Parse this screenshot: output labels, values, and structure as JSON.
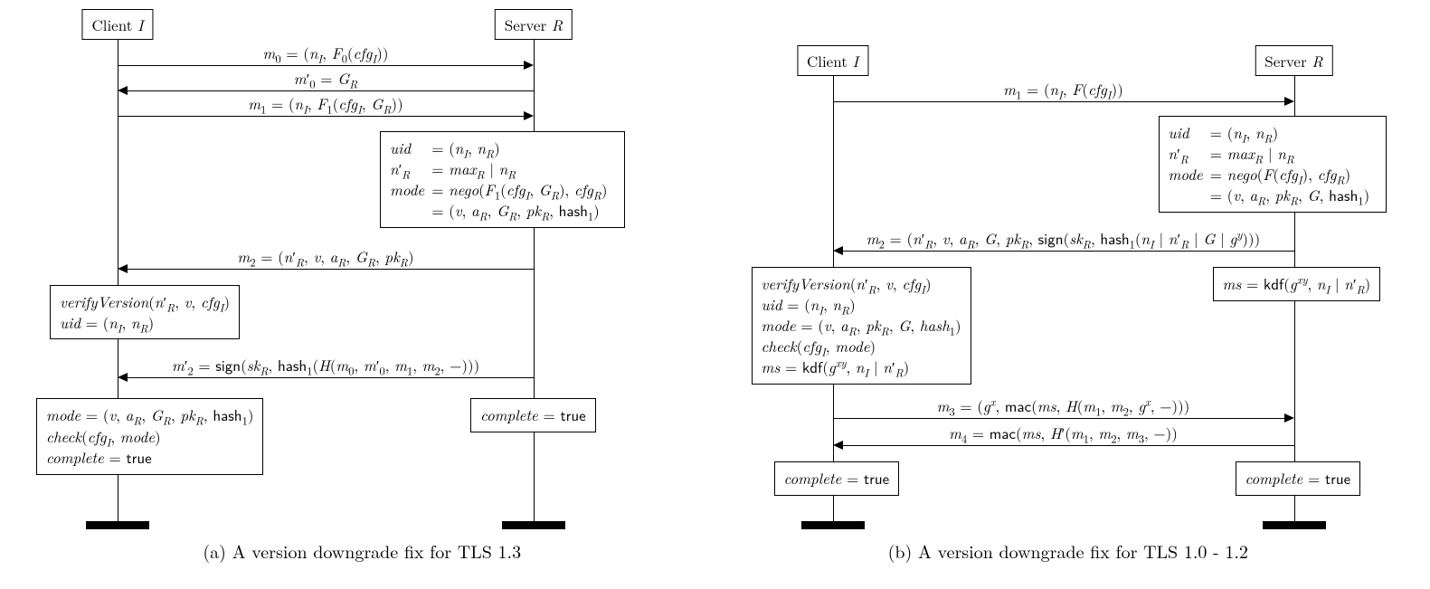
{
  "left": {
    "client_head": "Client <span class='it'>I</span>",
    "server_head": "Server <span class='it'>R</span>",
    "m0": "<span class='it'>m</span><sub>0</sub> = (<span class='it'>n<sub>I</sub></span>, <span class='it'>F</span><sub>0</sub>(<span class='it'>cfg<sub>I</sub></span>))",
    "m0p": "<span class='it'>m</span>′<sub>0</sub> = <span class='it'>G<sub>R</sub></span>",
    "m1": "<span class='it'>m</span><sub>1</sub> = (<span class='it'>n<sub>I</sub></span>, <span class='it'>F</span><sub>1</sub>(<span class='it'>cfg<sub>I</sub></span>, <span class='it'>G<sub>R</sub></span>))",
    "srv_note": "<div class='tbl'><div class='tr'><div class='td'><span class='it'>uid</span></div><div class='td'>= (<span class='it'>n<sub>I</sub></span>, <span class='it'>n<sub>R</sub></span>)</div></div><div class='tr'><div class='td'><span class='it'>n</span>′<sub><span class='it'>R</span></sub></div><div class='td'>= <span class='it'>max<sub>R</sub></span> | <span class='it'>n<sub>R</sub></span></div></div><div class='tr'><div class='td'><span class='it'>mode</span></div><div class='td'>= <span class='it'>nego</span>(<span class='it'>F</span><sub>1</sub>(<span class='it'>cfg<sub>I</sub></span>, <span class='it'>G<sub>R</sub></span>), <span class='it'>cfg<sub>R</sub></span>)</div></div><div class='tr'><div class='td'></div><div class='td'>= (<span class='it'>v</span>, <span class='it'>a<sub>R</sub></span>, <span class='it'>G<sub>R</sub></span>, <span class='it'>pk<sub>R</sub></span>, <span class='sf'>hash</span><sub>1</sub>)</div></div></div>",
    "m2": "<span class='it'>m</span><sub>2</sub> = (<span class='it'>n</span>′<sub><span class='it'>R</span></sub>, <span class='it'>v</span>, <span class='it'>a<sub>R</sub></span>, <span class='it'>G<sub>R</sub></span>, <span class='it'>pk<sub>R</sub></span>)",
    "cli_note1": "<span class='it'>verifyVersion</span>(<span class='it'>n</span>′<sub><span class='it'>R</span></sub>, <span class='it'>v</span>, <span class='it'>cfg<sub>I</sub></span>)<br><span class='it'>uid</span> = (<span class='it'>n<sub>I</sub></span>, <span class='it'>n<sub>R</sub></span>)",
    "m2p": "<span class='it'>m</span>′<sub>2</sub> = <span class='sf'>sign</span>(<span class='it'>sk<sub>R</sub></span>, <span class='sf'>hash</span><sub>1</sub>(<span class='it'>H</span>(<span class='it'>m</span><sub>0</sub>, <span class='it'>m</span>′<sub>0</sub>, <span class='it'>m</span><sub>1</sub>, <span class='it'>m</span><sub>2</sub>, −)))",
    "cli_note2": "<span class='it'>mode</span> = (<span class='it'>v</span>, <span class='it'>a<sub>R</sub></span>, <span class='it'>G<sub>R</sub></span>, <span class='it'>pk<sub>R</sub></span>, <span class='sf'>hash</span><sub>1</sub>)<br><span class='it'>check</span>(<span class='it'>cfg<sub>I</sub></span>, <span class='it'>mode</span>)<br><span class='it'>complete</span> = <span class='sf'>true</span>",
    "srv_note2": "<span class='it'>complete</span> = <span class='sf'>true</span>",
    "caption": "(a) A version downgrade fix for TLS 1.3"
  },
  "right": {
    "client_head": "Client <span class='it'>I</span>",
    "server_head": "Server <span class='it'>R</span>",
    "m1": "<span class='it'>m</span><sub>1</sub> = (<span class='it'>n<sub>I</sub></span>, <span class='it'>F</span>(<span class='it'>cfg<sub>I</sub></span>))",
    "srv_note": "<div class='tbl'><div class='tr'><div class='td'><span class='it'>uid</span></div><div class='td'>= (<span class='it'>n<sub>I</sub></span>, <span class='it'>n<sub>R</sub></span>)</div></div><div class='tr'><div class='td'><span class='it'>n</span>′<sub><span class='it'>R</span></sub></div><div class='td'>= <span class='it'>max<sub>R</sub></span> | <span class='it'>n<sub>R</sub></span></div></div><div class='tr'><div class='td'><span class='it'>mode</span></div><div class='td'>= <span class='it'>nego</span>(<span class='it'>F</span>(<span class='it'>cfg<sub>I</sub></span>), <span class='it'>cfg<sub>R</sub></span>)</div></div><div class='tr'><div class='td'></div><div class='td'>= (<span class='it'>v</span>, <span class='it'>a<sub>R</sub></span>, <span class='it'>pk<sub>R</sub></span>, <span class='it'>G</span>, <span class='sf'>hash</span><sub>1</sub>)</div></div></div>",
    "m2": "<span class='it'>m</span><sub>2</sub> = (<span class='it'>n</span>′<sub><span class='it'>R</span></sub>, <span class='it'>v</span>, <span class='it'>a<sub>R</sub></span>, <span class='it'>G</span>, <span class='it'>pk<sub>R</sub></span>, <span class='sf'>sign</span>(<span class='it'>sk<sub>R</sub></span>, <span class='sf'>hash</span><sub>1</sub>(<span class='it'>n<sub>I</sub></span> | <span class='it'>n</span>′<sub><span class='it'>R</span></sub> | <span class='it'>G</span> | <span class='it'>g<sup>y</sup></span>)))",
    "srv_note2": "<span class='it'>ms</span> = <span class='sf'>kdf</span>(<span class='it'>g<sup>xy</sup></span>, <span class='it'>n<sub>I</sub></span> | <span class='it'>n</span>′<sub><span class='it'>R</span></sub>)",
    "cli_note": "<span class='it'>verifyVersion</span>(<span class='it'>n</span>′<sub><span class='it'>R</span></sub>, <span class='it'>v</span>, <span class='it'>cfg<sub>I</sub></span>)<br><span class='it'>uid</span> = (<span class='it'>n<sub>I</sub></span>, <span class='it'>n<sub>R</sub></span>)<br><span class='it'>mode</span> = (<span class='it'>v</span>, <span class='it'>a<sub>R</sub></span>, <span class='it'>pk<sub>R</sub></span>, <span class='it'>G</span>, <span class='it'>hash</span><sub>1</sub>)<br><span class='it'>check</span>(<span class='it'>cfg<sub>I</sub></span>, <span class='it'>mode</span>)<br><span class='it'>ms</span> = <span class='sf'>kdf</span>(<span class='it'>g<sup>xy</sup></span>, <span class='it'>n<sub>I</sub></span> | <span class='it'>n</span>′<sub><span class='it'>R</span></sub>)",
    "m3": "<span class='it'>m</span><sub>3</sub> = (<span class='it'>g<sup>x</sup></span>, <span class='sf'>mac</span>(<span class='it'>ms</span>, <span class='it'>H</span>(<span class='it'>m</span><sub>1</sub>, <span class='it'>m</span><sub>2</sub>, <span class='it'>g<sup>x</sup></span>, −)))",
    "m4": "<span class='it'>m</span><sub>4</sub> = <span class='sf'>mac</span>(<span class='it'>ms</span>, <span class='it'>H</span>′(<span class='it'>m</span><sub>1</sub>, <span class='it'>m</span><sub>2</sub>, <span class='it'>m</span><sub>3</sub>, −))",
    "complete_c": "<span class='it'>complete</span> = <span class='sf'>true</span>",
    "complete_s": "<span class='it'>complete</span> = <span class='sf'>true</span>",
    "caption": "(b) A version downgrade fix for TLS 1.0 - 1.2"
  }
}
